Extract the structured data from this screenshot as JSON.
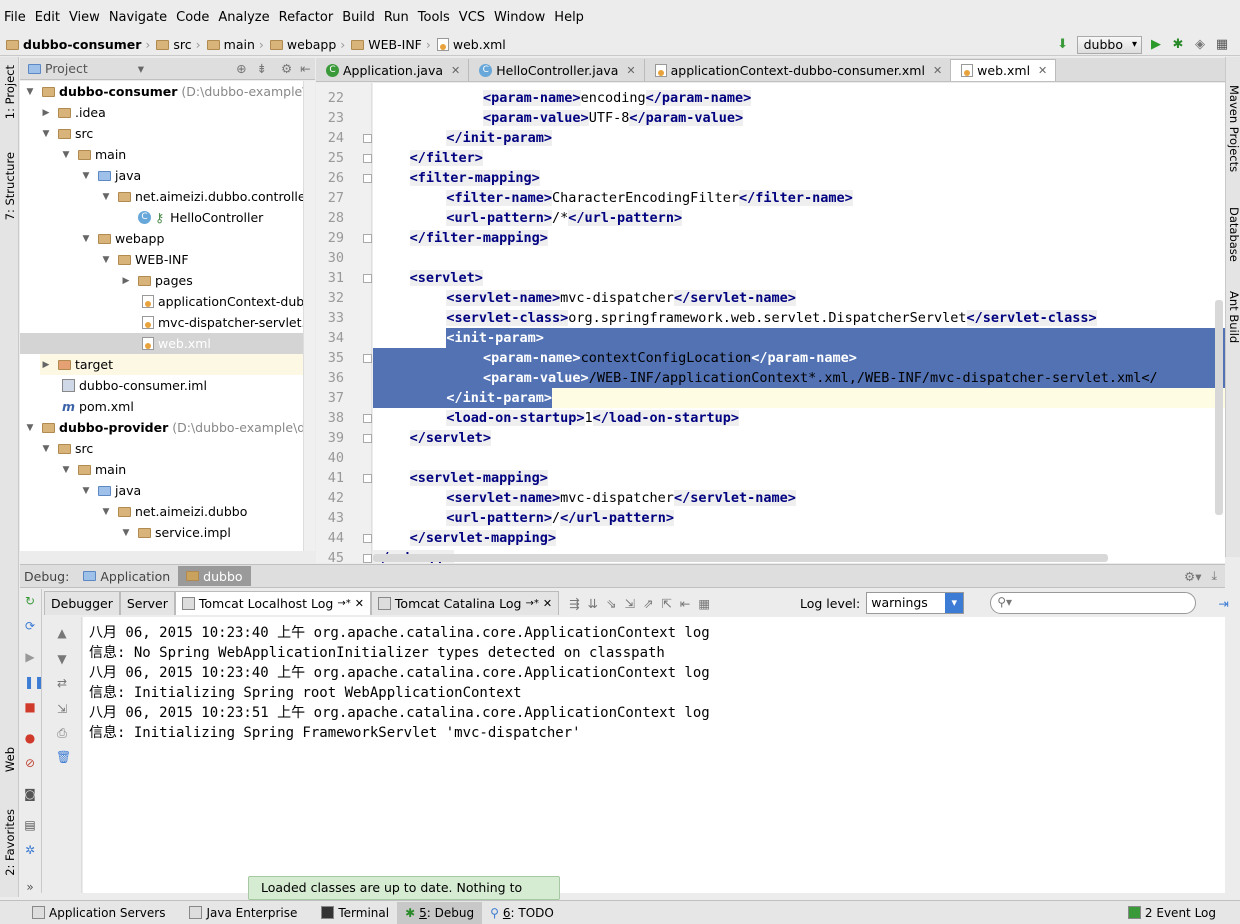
{
  "menu": [
    "File",
    "Edit",
    "View",
    "Navigate",
    "Code",
    "Analyze",
    "Refactor",
    "Build",
    "Run",
    "Tools",
    "VCS",
    "Window",
    "Help"
  ],
  "breadcrumb": [
    "dubbo-consumer",
    "src",
    "main",
    "webapp",
    "WEB-INF",
    "web.xml"
  ],
  "run_config": "dubbo",
  "project_panel": {
    "title": "Project"
  },
  "side_tabs": {
    "left_top": [
      "1: Project",
      "7: Structure"
    ],
    "left_bottom": [
      "Web",
      "2: Favorites"
    ],
    "right": [
      "Maven Projects",
      "Database",
      "Ant Build"
    ]
  },
  "tree": [
    {
      "label": "dubbo-consumer",
      "hint": "(D:\\dubbo-example\\du",
      "bold": true
    },
    {
      "label": ".idea"
    },
    {
      "label": "src"
    },
    {
      "label": "main"
    },
    {
      "label": "java"
    },
    {
      "label": "net.aimeizi.dubbo.controller"
    },
    {
      "label": "HelloController"
    },
    {
      "label": "webapp"
    },
    {
      "label": "WEB-INF"
    },
    {
      "label": "pages"
    },
    {
      "label": "applicationContext-dubb"
    },
    {
      "label": "mvc-dispatcher-servlet.x"
    },
    {
      "label": "web.xml"
    },
    {
      "label": "target"
    },
    {
      "label": "dubbo-consumer.iml"
    },
    {
      "label": "pom.xml"
    },
    {
      "label": "dubbo-provider",
      "hint": "(D:\\dubbo-example\\dub",
      "bold": true
    },
    {
      "label": "src"
    },
    {
      "label": "main"
    },
    {
      "label": "java"
    },
    {
      "label": "net.aimeizi.dubbo"
    },
    {
      "label": "service.impl"
    }
  ],
  "editor_tabs": [
    {
      "label": "Application.java"
    },
    {
      "label": "HelloController.java"
    },
    {
      "label": "applicationContext-dubbo-consumer.xml"
    },
    {
      "label": "web.xml"
    }
  ],
  "code_lines": [
    {
      "n": "22",
      "t": [
        "",
        "<param-name>",
        "encoding",
        "</param-name>"
      ]
    },
    {
      "n": "23",
      "t": [
        "",
        "<param-value>",
        "UTF-8",
        "</param-value>"
      ]
    },
    {
      "n": "24",
      "t": [
        "",
        "</init-param>"
      ]
    },
    {
      "n": "25",
      "t": [
        "",
        "</filter>"
      ]
    },
    {
      "n": "26",
      "t": [
        "",
        "<filter-mapping>"
      ]
    },
    {
      "n": "27",
      "t": [
        "",
        "<filter-name>",
        "CharacterEncodingFilter",
        "</filter-name>"
      ]
    },
    {
      "n": "28",
      "t": [
        "",
        "<url-pattern>",
        "/*",
        "</url-pattern>"
      ]
    },
    {
      "n": "29",
      "t": [
        "",
        "</filter-mapping>"
      ]
    },
    {
      "n": "30",
      "t": [
        ""
      ]
    },
    {
      "n": "31",
      "t": [
        "",
        "<servlet>"
      ]
    },
    {
      "n": "32",
      "t": [
        "",
        "<servlet-name>",
        "mvc-dispatcher",
        "</servlet-name>"
      ]
    },
    {
      "n": "33",
      "t": [
        "",
        "<servlet-class>",
        "org.springframework.web.servlet.DispatcherServlet",
        "</servlet-class>"
      ]
    },
    {
      "n": "34",
      "t": [
        "",
        "<init-param>"
      ]
    },
    {
      "n": "35",
      "t": [
        "",
        "<param-name>",
        "contextConfigLocation",
        "</param-name>"
      ]
    },
    {
      "n": "36",
      "t": [
        "",
        "<param-value>",
        "/WEB-INF/applicationContext*.xml,/WEB-INF/mvc-dispatcher-servlet.xml<",
        "/"
      ]
    },
    {
      "n": "37",
      "t": [
        "",
        "</init-param>"
      ]
    },
    {
      "n": "38",
      "t": [
        "",
        "<load-on-startup>",
        "1",
        "</load-on-startup>"
      ]
    },
    {
      "n": "39",
      "t": [
        "",
        "</servlet>"
      ]
    },
    {
      "n": "40",
      "t": [
        ""
      ]
    },
    {
      "n": "41",
      "t": [
        "",
        "<servlet-mapping>"
      ]
    },
    {
      "n": "42",
      "t": [
        "",
        "<servlet-name>",
        "mvc-dispatcher",
        "</servlet-name>"
      ]
    },
    {
      "n": "43",
      "t": [
        "",
        "<url-pattern>",
        "/",
        "</url-pattern>"
      ]
    },
    {
      "n": "44",
      "t": [
        "",
        "</servlet-mapping>"
      ]
    },
    {
      "n": "45",
      "t": [
        "",
        "</web-app>"
      ]
    }
  ],
  "debug": {
    "label": "Debug:",
    "sessions": [
      "Application",
      "dubbo"
    ],
    "tabs": [
      "Debugger",
      "Server",
      "Tomcat Localhost Log",
      "Tomcat Catalina Log"
    ],
    "log_level_label": "Log level:",
    "log_level": "warnings",
    "log": [
      "八月 06, 2015 10:23:40 上午 org.apache.catalina.core.ApplicationContext log",
      "信息: No Spring WebApplicationInitializer types detected on classpath",
      "八月 06, 2015 10:23:40 上午 org.apache.catalina.core.ApplicationContext log",
      "信息: Initializing Spring root WebApplicationContext",
      "八月 06, 2015 10:23:51 上午 org.apache.catalina.core.ApplicationContext log",
      "信息: Initializing Spring FrameworkServlet 'mvc-dispatcher'"
    ]
  },
  "toast": "Loaded classes are up to date. Nothing to reload.",
  "statusbar": {
    "app_servers": "Application Servers",
    "java_ent": "Java Enterprise",
    "terminal": "Terminal",
    "debug_num": "5",
    "debug": ": Debug",
    "todo_num": "6",
    "todo": ": TODO",
    "event_log": "2 Event Log"
  },
  "colors": {
    "selection": "#5272b4",
    "tag": "#000080",
    "toast_bg": "#d5ecd2",
    "accent": "#3d7cd4"
  }
}
